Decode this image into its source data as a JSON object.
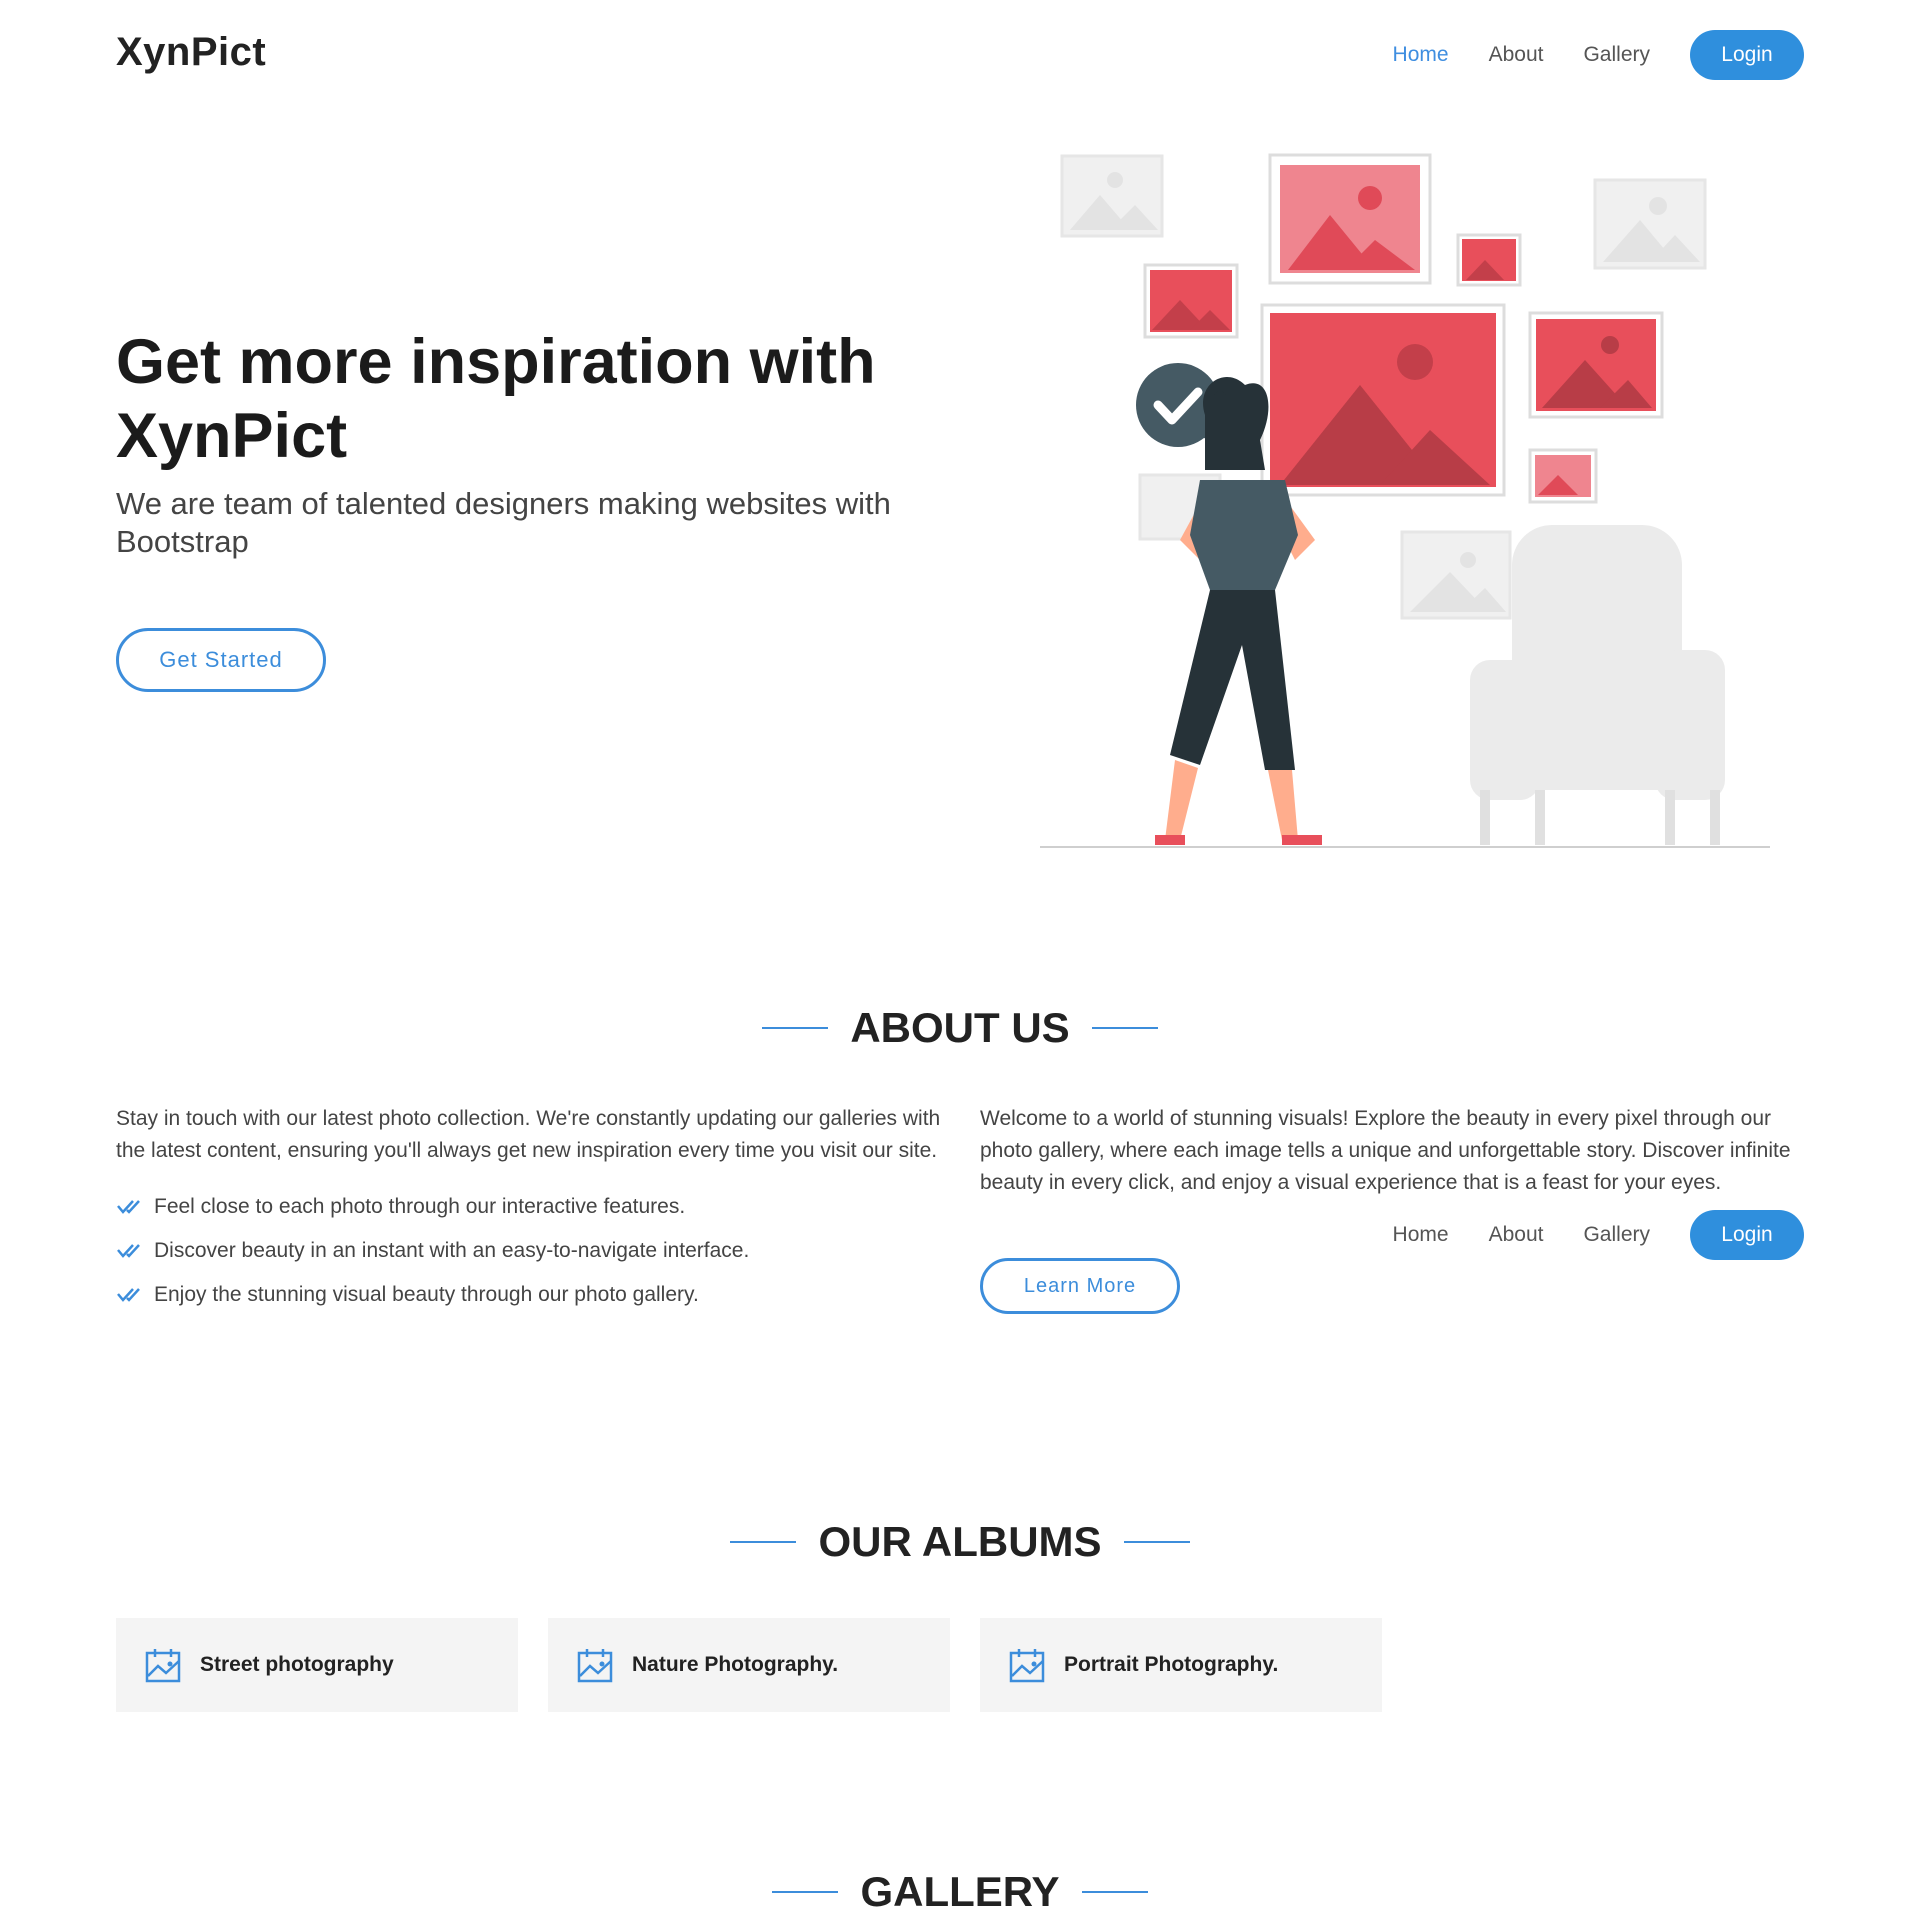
{
  "header": {
    "logo": "XynPict",
    "nav": {
      "home": "Home",
      "about": "About",
      "gallery": "Gallery"
    },
    "login": "Login"
  },
  "hero": {
    "title": "Get more inspiration with XynPict",
    "subtitle": "We are team of talented designers making websites with Bootstrap",
    "cta": "Get Started"
  },
  "about": {
    "heading": "ABOUT US",
    "left_paragraph": "Stay in touch with our latest photo collection. We're constantly updating our galleries with the latest content, ensuring you'll always get new inspiration every time you visit our site.",
    "features": [
      "Feel close to each photo through our interactive features.",
      "Discover beauty in an instant with an easy-to-navigate interface.",
      "Enjoy the stunning visual beauty through our photo gallery."
    ],
    "right_paragraph": "Welcome to a world of stunning visuals! Explore the beauty in every pixel through our photo gallery, where each image tells a unique and unforgettable story. Discover infinite beauty in every click, and enjoy a visual experience that is a feast for your eyes.",
    "learn_more": "Learn More",
    "nav": {
      "home": "Home",
      "about": "About",
      "gallery": "Gallery"
    },
    "login": "Login"
  },
  "albums": {
    "heading": "OUR ALBUMS",
    "items": [
      {
        "label": "Street photography"
      },
      {
        "label": "Nature Photography."
      },
      {
        "label": "Portrait Photography."
      }
    ]
  },
  "gallery": {
    "heading": "GALLERY"
  },
  "colors": {
    "accent": "#2f8fdd",
    "illustration_red": "#e84f5b",
    "dark": "#263238"
  }
}
